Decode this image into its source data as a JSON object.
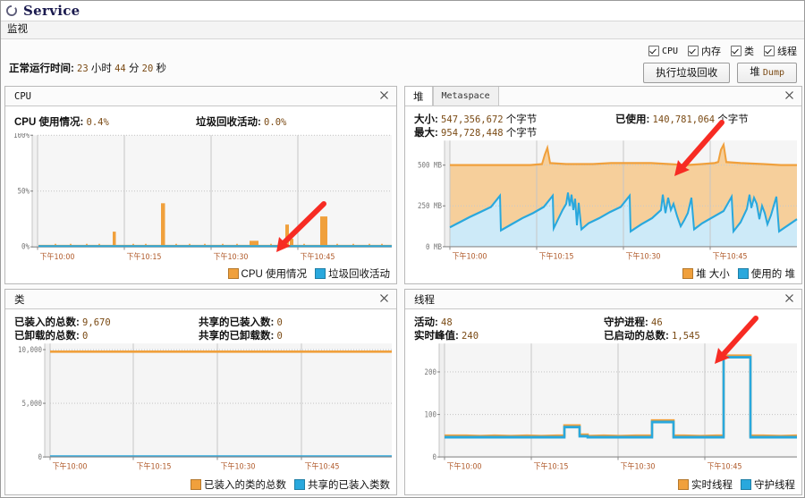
{
  "window": {
    "title": "Service",
    "icon": "service-circle-icon"
  },
  "menubar": {
    "items": [
      {
        "label": "监视"
      }
    ]
  },
  "toolbar": {
    "checkboxes": [
      {
        "label": "CPU",
        "checked": true,
        "mono": true
      },
      {
        "label": "内存",
        "checked": true,
        "mono": false
      },
      {
        "label": "类",
        "checked": true,
        "mono": false
      },
      {
        "label": "线程",
        "checked": true,
        "mono": false
      }
    ],
    "gc_button": "执行垃圾回收",
    "heapdump_button_cn": "堆",
    "heapdump_button_en": "Dump"
  },
  "uptime": {
    "label": "正常运行时间:",
    "hours": "23",
    "hours_unit": "小时",
    "minutes": "44",
    "minutes_unit": "分",
    "seconds": "20",
    "seconds_unit": "秒"
  },
  "panels": {
    "cpu": {
      "title": "CPU",
      "close": "×",
      "stats": [
        {
          "label": "CPU 使用情况:",
          "value": "0.4%"
        },
        {
          "label": "垃圾回收活动:",
          "value": "0.0%"
        }
      ],
      "legend": [
        {
          "label": "CPU 使用情况",
          "color": "#f0a03c"
        },
        {
          "label": "垃圾回收活动",
          "color": "#29a8dd"
        }
      ]
    },
    "heap": {
      "tab_active": "堆",
      "tab_inactive": "Metaspace",
      "close": "×",
      "stats": [
        {
          "label": "大小:",
          "value": "547,356,672",
          "unit": "个字节"
        },
        {
          "label": "最大:",
          "value": "954,728,448",
          "unit": "个字节"
        },
        {
          "label": "已使用:",
          "value": "140,781,064",
          "unit": "个字节"
        }
      ],
      "legend": [
        {
          "label": "堆 大小",
          "color": "#f0a03c"
        },
        {
          "label": "使用的 堆",
          "color": "#29a8dd"
        }
      ]
    },
    "classes": {
      "title": "类",
      "close": "×",
      "stats": [
        {
          "label": "已装入的总数:",
          "value": "9,670"
        },
        {
          "label": "已卸载的总数:",
          "value": "0"
        },
        {
          "label": "共享的已装入数:",
          "value": "0"
        },
        {
          "label": "共享的已卸载数:",
          "value": "0"
        }
      ],
      "legend": [
        {
          "label": "已装入的类的总数",
          "color": "#f0a03c"
        },
        {
          "label": "共享的已装入类数",
          "color": "#29a8dd"
        }
      ]
    },
    "threads": {
      "title": "线程",
      "close": "×",
      "stats": [
        {
          "label": "活动:",
          "value": "48"
        },
        {
          "label": "实时峰值:",
          "value": "240"
        },
        {
          "label": "守护进程:",
          "value": "46"
        },
        {
          "label": "已启动的总数:",
          "value": "1,545"
        }
      ],
      "legend": [
        {
          "label": "实时线程",
          "color": "#f0a03c"
        },
        {
          "label": "守护线程",
          "color": "#29a8dd"
        }
      ]
    }
  },
  "annotations": {
    "arrows": [
      {
        "target": "cpu-spike-near-1045",
        "color": "#f72b23"
      },
      {
        "target": "heap-size-near-1045",
        "color": "#f72b23"
      },
      {
        "target": "thread-total-started",
        "color": "#f72b23"
      }
    ]
  },
  "chart_data": [
    {
      "id": "cpu",
      "type": "area",
      "title": "CPU",
      "xlabel": "",
      "ylabel": "",
      "grid": true,
      "legend_position": "bottom-right",
      "ylim": [
        0,
        100
      ],
      "yticks": [
        "0%",
        "50%",
        "100%"
      ],
      "ytick_values": [
        0,
        50,
        100
      ],
      "xticks": [
        "下午10:00",
        "下午10:15",
        "下午10:30",
        "下午10:45"
      ],
      "xtick_positions": [
        0.055,
        0.305,
        0.555,
        0.805
      ],
      "series": [
        {
          "name": "CPU 使用情况",
          "color": "#f0a03c",
          "x": [
            0.0,
            0.03,
            0.05,
            0.07,
            0.09,
            0.12,
            0.14,
            0.16,
            0.18,
            0.2,
            0.215,
            0.222,
            0.23,
            0.25,
            0.27,
            0.29,
            0.31,
            0.33,
            0.345,
            0.352,
            0.359,
            0.366,
            0.374,
            0.39,
            0.41,
            0.43,
            0.45,
            0.47,
            0.49,
            0.51,
            0.53,
            0.55,
            0.57,
            0.59,
            0.605,
            0.615,
            0.625,
            0.635,
            0.645,
            0.66,
            0.68,
            0.7,
            0.715,
            0.722,
            0.73,
            0.74,
            0.75,
            0.77,
            0.785,
            0.792,
            0.8,
            0.807,
            0.814,
            0.822,
            0.83,
            0.85,
            0.87,
            0.89,
            0.91,
            0.93,
            0.95,
            0.97,
            1.0
          ],
          "y": [
            1,
            1,
            2,
            1,
            1,
            2,
            1,
            1,
            2,
            1,
            14,
            13,
            1,
            2,
            1,
            1,
            2,
            1,
            39,
            40,
            38,
            2,
            1,
            1,
            2,
            1,
            1,
            2,
            1,
            1,
            2,
            1,
            1,
            2,
            5,
            7,
            6,
            5,
            2,
            1,
            1,
            1,
            20,
            19,
            6,
            5,
            2,
            1,
            27,
            28,
            27,
            27,
            2,
            1,
            2,
            1,
            2,
            1,
            1,
            2,
            1,
            1,
            1
          ]
        },
        {
          "name": "垃圾回收活动",
          "color": "#29a8dd",
          "x": [
            0,
            0.25,
            0.5,
            0.75,
            1.0
          ],
          "y": [
            0.5,
            0.5,
            0.5,
            0.5,
            0.5
          ]
        }
      ]
    },
    {
      "id": "heap",
      "type": "area",
      "title": "堆",
      "xlabel": "",
      "ylabel": "",
      "grid": true,
      "legend_position": "bottom-right",
      "ylim": [
        0,
        650
      ],
      "yunit": "MB",
      "yticks": [
        "0 MB",
        "250 MB",
        "500 MB"
      ],
      "ytick_values": [
        0,
        250,
        500
      ],
      "xticks": [
        "下午10:00",
        "下午10:15",
        "下午10:30",
        "下午10:45"
      ],
      "xtick_positions": [
        0.055,
        0.305,
        0.555,
        0.805
      ],
      "series": [
        {
          "name": "堆 大小",
          "color": "#f0a03c",
          "fill": "#f6cf9b",
          "x": [
            0.0,
            0.1,
            0.2,
            0.3,
            0.345,
            0.352,
            0.36,
            0.368,
            0.4,
            0.47,
            0.52,
            0.58,
            0.62,
            0.66,
            0.7,
            0.74,
            0.78,
            0.795,
            0.802,
            0.81,
            0.818,
            0.84,
            0.9,
            0.96,
            1.0
          ],
          "y": [
            522,
            522,
            522,
            522,
            524,
            570,
            600,
            530,
            524,
            524,
            526,
            526,
            526,
            524,
            522,
            524,
            524,
            528,
            590,
            612,
            532,
            524,
            522,
            520,
            518
          ]
        },
        {
          "name": "使用的 堆",
          "color": "#29a8dd",
          "fill": "#cdeaf8",
          "x": [
            0.0,
            0.03,
            0.06,
            0.09,
            0.12,
            0.145,
            0.15,
            0.18,
            0.21,
            0.24,
            0.27,
            0.295,
            0.3,
            0.325,
            0.335,
            0.34,
            0.345,
            0.35,
            0.355,
            0.36,
            0.365,
            0.37,
            0.378,
            0.39,
            0.42,
            0.45,
            0.48,
            0.505,
            0.51,
            0.53,
            0.56,
            0.585,
            0.59,
            0.596,
            0.603,
            0.61,
            0.617,
            0.625,
            0.635,
            0.645,
            0.655,
            0.665,
            0.67,
            0.69,
            0.71,
            0.73,
            0.752,
            0.757,
            0.775,
            0.79,
            0.797,
            0.802,
            0.808,
            0.815,
            0.822,
            0.83,
            0.838,
            0.845,
            0.853,
            0.86,
            0.868,
            0.877,
            0.882,
            0.9,
            0.93,
            0.955,
            0.96,
            0.98,
            1.0
          ],
          "y": [
            110,
            135,
            160,
            185,
            210,
            265,
            95,
            125,
            155,
            185,
            215,
            262,
            90,
            180,
            215,
            270,
            200,
            258,
            175,
            235,
            100,
            195,
            92,
            120,
            150,
            185,
            215,
            262,
            88,
            125,
            160,
            200,
            255,
            150,
            235,
            120,
            205,
            155,
            100,
            130,
            160,
            195,
            260,
            100,
            140,
            175,
            250,
            90,
            135,
            195,
            265,
            180,
            245,
            130,
            215,
            165,
            105,
            140,
            180,
            215,
            255,
            100,
            88,
            130,
            170,
            258,
            92,
            115,
            150
          ]
        }
      ]
    },
    {
      "id": "classes",
      "type": "line",
      "title": "类",
      "xlabel": "",
      "ylabel": "",
      "grid": true,
      "legend_position": "bottom-right",
      "ylim": [
        0,
        10800
      ],
      "yticks": [
        "0",
        "5,000",
        "10,000"
      ],
      "ytick_values": [
        0,
        5000,
        10000
      ],
      "xticks": [
        "下午10:00",
        "下午10:15",
        "下午10:30",
        "下午10:45"
      ],
      "xtick_positions": [
        0.055,
        0.305,
        0.555,
        0.805
      ],
      "series": [
        {
          "name": "已装入的类的总数",
          "color": "#f0a03c",
          "x": [
            0,
            0.25,
            0.5,
            0.75,
            1.0
          ],
          "y": [
            9660,
            9665,
            9668,
            9670,
            9670
          ]
        },
        {
          "name": "共享的已装入类数",
          "color": "#29a8dd",
          "x": [
            0,
            0.25,
            0.5,
            0.75,
            1.0
          ],
          "y": [
            0,
            0,
            0,
            0,
            0
          ]
        }
      ]
    },
    {
      "id": "threads",
      "type": "line",
      "title": "线程",
      "xlabel": "",
      "ylabel": "",
      "grid": true,
      "legend_position": "bottom-right",
      "ylim": [
        0,
        260
      ],
      "yticks": [
        "0",
        "100",
        "200"
      ],
      "ytick_values": [
        0,
        100,
        200
      ],
      "xticks": [
        "下午10:00",
        "下午10:15",
        "下午10:30",
        "下午10:45"
      ],
      "xtick_positions": [
        0.055,
        0.305,
        0.555,
        0.805
      ],
      "series": [
        {
          "name": "实时线程",
          "color": "#f0a03c",
          "x": [
            0.0,
            0.06,
            0.1,
            0.14,
            0.18,
            0.22,
            0.26,
            0.3,
            0.33,
            0.345,
            0.352,
            0.365,
            0.378,
            0.385,
            0.4,
            0.44,
            0.48,
            0.52,
            0.56,
            0.6,
            0.615,
            0.625,
            0.66,
            0.675,
            0.685,
            0.7,
            0.74,
            0.78,
            0.8,
            0.815,
            0.822,
            0.862,
            0.87,
            0.9,
            0.95,
            1.0
          ],
          "y": [
            50,
            50,
            50,
            50,
            50,
            50,
            50,
            50,
            50,
            72,
            72,
            53,
            50,
            50,
            50,
            50,
            50,
            50,
            50,
            50,
            88,
            88,
            88,
            88,
            52,
            50,
            50,
            50,
            50,
            50,
            238,
            238,
            50,
            50,
            50,
            50
          ]
        },
        {
          "name": "守护线程",
          "color": "#29a8dd",
          "x": [
            0.0,
            0.06,
            0.1,
            0.14,
            0.18,
            0.22,
            0.26,
            0.3,
            0.33,
            0.345,
            0.352,
            0.365,
            0.378,
            0.385,
            0.4,
            0.44,
            0.48,
            0.52,
            0.56,
            0.6,
            0.615,
            0.625,
            0.66,
            0.675,
            0.685,
            0.7,
            0.74,
            0.78,
            0.8,
            0.815,
            0.822,
            0.862,
            0.87,
            0.9,
            0.95,
            1.0
          ],
          "y": [
            47,
            47,
            47,
            47,
            47,
            47,
            47,
            47,
            47,
            70,
            70,
            50,
            47,
            47,
            47,
            47,
            47,
            47,
            47,
            47,
            85,
            85,
            85,
            85,
            49,
            47,
            47,
            47,
            47,
            47,
            235,
            235,
            47,
            47,
            47,
            47
          ]
        }
      ]
    }
  ]
}
